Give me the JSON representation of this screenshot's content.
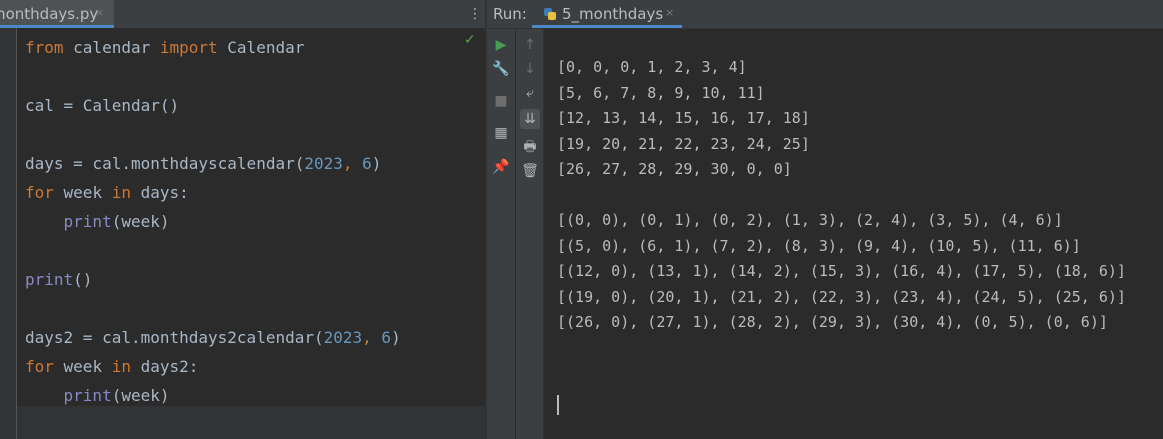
{
  "editor": {
    "tab": {
      "label": "monthdays.py",
      "close": "×"
    },
    "menu_glyph": "⋮",
    "status_glyph": "✓",
    "code": [
      [
        {
          "t": "from",
          "c": "kw"
        },
        {
          "t": " calendar "
        },
        {
          "t": "import",
          "c": "kw"
        },
        {
          "t": " Calendar"
        }
      ],
      [],
      [
        {
          "t": "cal = Calendar()"
        }
      ],
      [],
      [
        {
          "t": "days = cal.monthdayscalendar("
        },
        {
          "t": "2023",
          "c": "num"
        },
        {
          "t": ", ",
          "c": "kw"
        },
        {
          "t": "6",
          "c": "num"
        },
        {
          "t": ")"
        }
      ],
      [
        {
          "t": "for",
          "c": "kw"
        },
        {
          "t": " week "
        },
        {
          "t": "in",
          "c": "kw"
        },
        {
          "t": " days:"
        }
      ],
      [
        {
          "t": "    "
        },
        {
          "t": "print",
          "c": "bi"
        },
        {
          "t": "(week)"
        }
      ],
      [],
      [
        {
          "t": "print",
          "c": "bi"
        },
        {
          "t": "()"
        }
      ],
      [],
      [
        {
          "t": "days2 = cal.monthdays2calendar("
        },
        {
          "t": "2023",
          "c": "num"
        },
        {
          "t": ", ",
          "c": "kw"
        },
        {
          "t": "6",
          "c": "num"
        },
        {
          "t": ")"
        }
      ],
      [
        {
          "t": "for",
          "c": "kw"
        },
        {
          "t": " week "
        },
        {
          "t": "in",
          "c": "kw"
        },
        {
          "t": " days2:"
        }
      ],
      [
        {
          "t": "    "
        },
        {
          "t": "print",
          "c": "bi"
        },
        {
          "t": "(week)"
        }
      ]
    ]
  },
  "run": {
    "label": "Run:",
    "tab": {
      "label": "5_monthdays",
      "close": "×"
    },
    "toolbar_left": [
      {
        "name": "rerun-icon",
        "glyph": "▶",
        "color": "#499c54"
      },
      {
        "name": "wrench-icon",
        "glyph": "🔧",
        "color": "#afb1b3"
      },
      {
        "name": "stop-icon",
        "glyph": "■",
        "color": "#6e6e6e"
      },
      {
        "name": "layout-icon",
        "glyph": "▦",
        "color": "#afb1b3"
      },
      {
        "name": "pin-icon",
        "glyph": "📌",
        "color": "#afb1b3"
      }
    ],
    "toolbar_right": [
      {
        "name": "up-arrow-icon",
        "glyph": "↑",
        "color": "#6e6e6e"
      },
      {
        "name": "down-arrow-icon",
        "glyph": "↓",
        "color": "#6e6e6e"
      },
      {
        "name": "soft-wrap-icon",
        "glyph": "⤶",
        "color": "#afb1b3"
      },
      {
        "name": "scroll-to-end-icon",
        "glyph": "⇊",
        "color": "#afb1b3"
      },
      {
        "name": "print-icon",
        "glyph": "🖶",
        "color": "#afb1b3"
      },
      {
        "name": "trash-icon",
        "glyph": "🗑",
        "color": "#afb1b3"
      }
    ],
    "output": [
      "[0, 0, 0, 1, 2, 3, 4]",
      "[5, 6, 7, 8, 9, 10, 11]",
      "[12, 13, 14, 15, 16, 17, 18]",
      "[19, 20, 21, 22, 23, 24, 25]",
      "[26, 27, 28, 29, 30, 0, 0]",
      "",
      "[(0, 0), (0, 1), (0, 2), (1, 3), (2, 4), (3, 5), (4, 6)]",
      "[(5, 0), (6, 1), (7, 2), (8, 3), (9, 4), (10, 5), (11, 6)]",
      "[(12, 0), (13, 1), (14, 2), (15, 3), (16, 4), (17, 5), (18, 6)]",
      "[(19, 0), (20, 1), (21, 2), (22, 3), (23, 4), (24, 5), (25, 6)]",
      "[(26, 0), (27, 1), (28, 2), (29, 3), (30, 4), (0, 5), (0, 6)]"
    ]
  }
}
